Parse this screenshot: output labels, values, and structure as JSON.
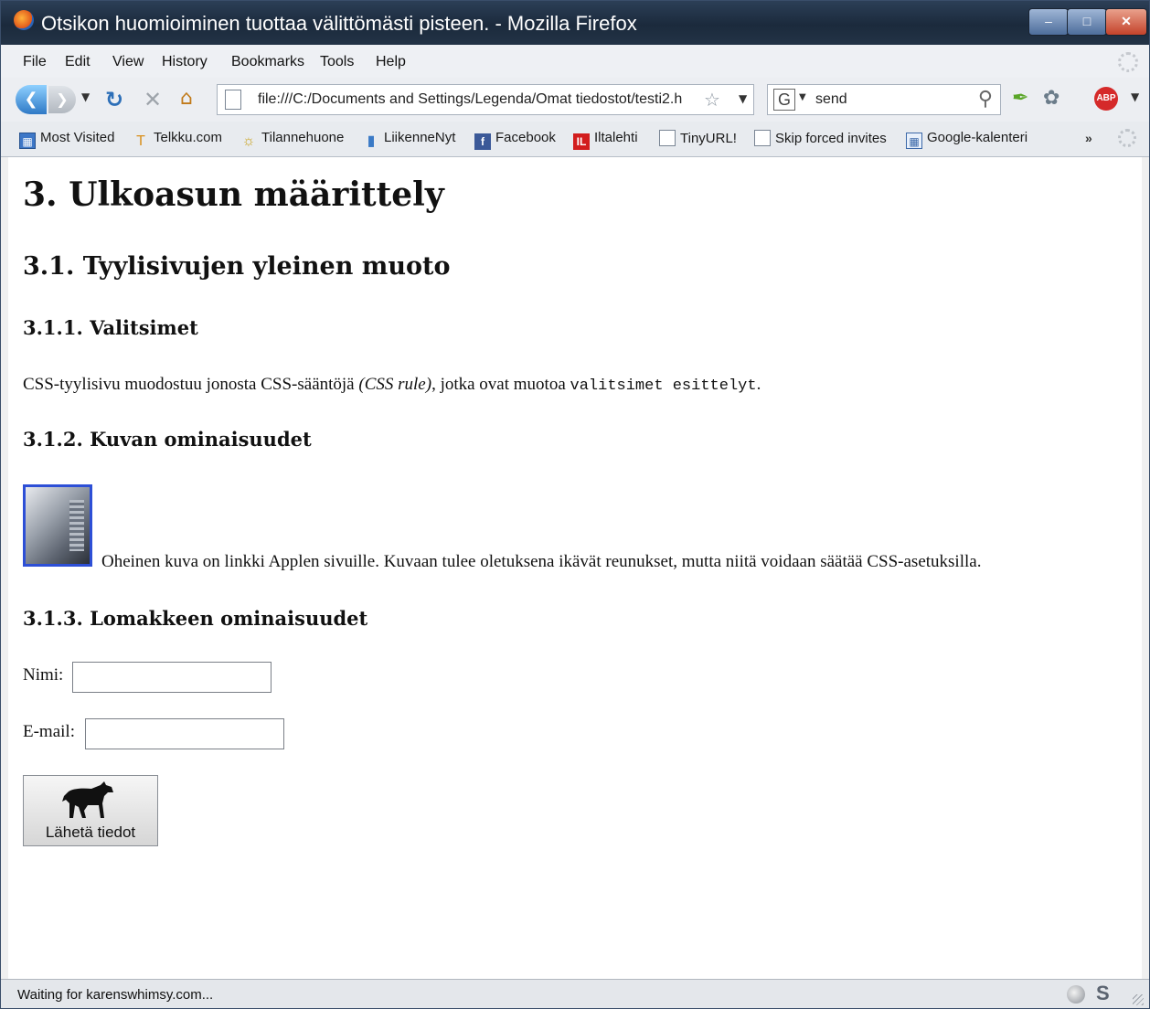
{
  "window": {
    "title": "Otsikon huomioiminen tuottaa välittömästi pisteen. - Mozilla Firefox",
    "controls": {
      "minimize": "–",
      "maximize": "□",
      "close": "✕"
    }
  },
  "menu": [
    "File",
    "Edit",
    "View",
    "History",
    "Bookmarks",
    "Tools",
    "Help"
  ],
  "navigation": {
    "url": "file:///C:/Documents and Settings/Legenda/Omat tiedostot/testi2.h",
    "search_value": "send"
  },
  "bookmarks": [
    {
      "label": "Most Visited",
      "icon": "most-visited-icon"
    },
    {
      "label": "Telkku.com",
      "icon": "telkku-icon"
    },
    {
      "label": "Tilannehuone",
      "icon": "tilannehuone-icon"
    },
    {
      "label": "LiikenneNyt",
      "icon": "liikennenyt-icon"
    },
    {
      "label": "Facebook",
      "icon": "facebook-icon"
    },
    {
      "label": "Iltalehti",
      "icon": "iltalehti-icon"
    },
    {
      "label": "TinyURL!",
      "icon": "page-icon"
    },
    {
      "label": "Skip forced invites",
      "icon": "page-icon"
    },
    {
      "label": "Google-kalenteri",
      "icon": "calendar-icon"
    }
  ],
  "page": {
    "h1": "3. Ulkoasun määrittely",
    "h2": "3.1. Tyylisivujen yleinen muoto",
    "sections": [
      {
        "heading": "3.1.1. Valitsimet"
      },
      {
        "heading": "3.1.2. Kuvan ominaisuudet"
      },
      {
        "heading": "3.1.3. Lomakkeen ominaisuudet"
      }
    ],
    "paragraph1": {
      "before": "CSS-tyylisivu muodostuu jonosta CSS-sääntöjä ",
      "emphasis": "(CSS rule)",
      "middle": ", jotka ovat muotoa ",
      "code": "valitsimet esittelyt",
      "after": "."
    },
    "image_caption": "Oheinen kuva on linkki Applen sivuille. Kuvaan tulee oletuksena ikävät reunukset, mutta niitä voidaan säätää CSS-asetuksilla.",
    "form": {
      "name_label": "Nimi:",
      "email_label": "E-mail:",
      "name_value": "",
      "email_value": "",
      "submit_label": "Lähetä tiedot"
    }
  },
  "status": {
    "text": "Waiting for karenswhimsy.com..."
  }
}
